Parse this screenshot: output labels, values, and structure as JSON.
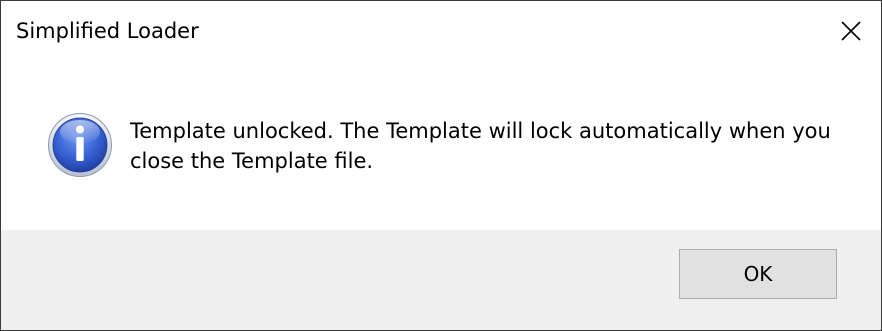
{
  "window": {
    "title": "Simplified Loader",
    "close_icon": "close-icon"
  },
  "message": {
    "icon": "info-icon",
    "text": "Template unlocked. The Template will lock automatically when you close the Template file."
  },
  "buttons": {
    "ok_label": "OK"
  },
  "colors": {
    "footer_background": "#f0f0f0",
    "button_background": "#e1e1e1",
    "button_border": "#adadad",
    "icon_blue": "#2f56c8"
  }
}
